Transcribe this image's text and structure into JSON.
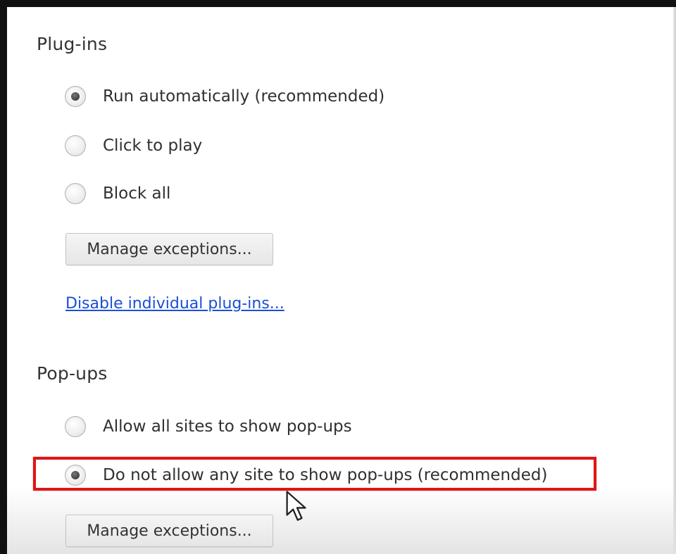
{
  "plugins": {
    "title": "Plug-ins",
    "options": [
      {
        "label": "Run automatically (recommended)",
        "checked": true
      },
      {
        "label": "Click to play",
        "checked": false
      },
      {
        "label": "Block all",
        "checked": false
      }
    ],
    "manage_button": "Manage exceptions...",
    "disable_link": "Disable individual plug-ins..."
  },
  "popups": {
    "title": "Pop-ups",
    "options": [
      {
        "label": "Allow all sites to show pop-ups",
        "checked": false
      },
      {
        "label": "Do not allow any site to show pop-ups (recommended)",
        "checked": true
      }
    ],
    "manage_button": "Manage exceptions..."
  },
  "annotation": {
    "highlight_color": "#e01515",
    "highlighted_option": "Do not allow any site to show pop-ups (recommended)"
  },
  "icons": {
    "cursor": "mouse-pointer-icon"
  }
}
